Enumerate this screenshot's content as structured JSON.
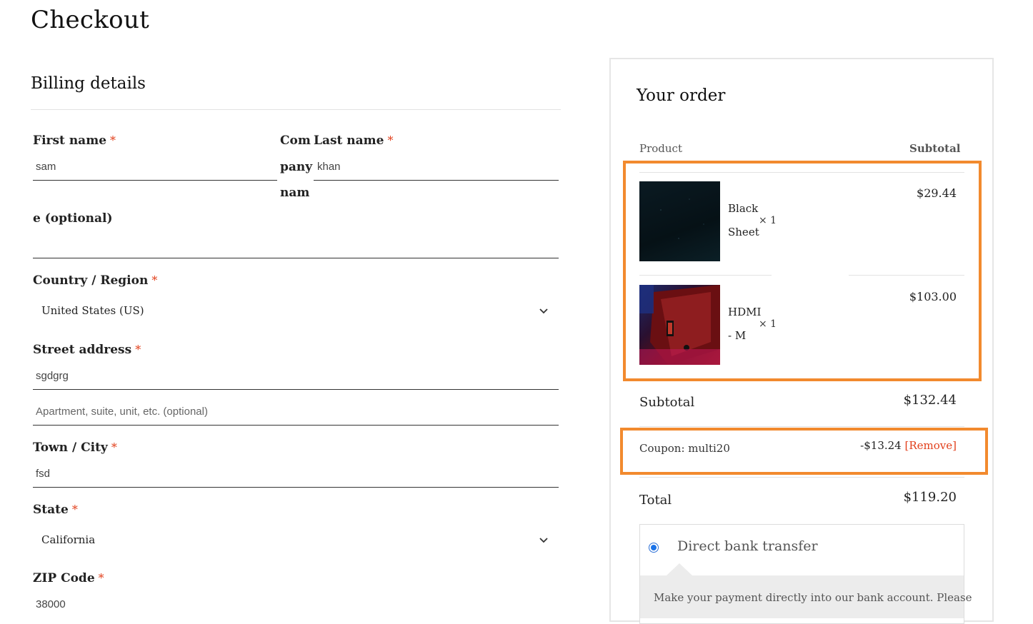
{
  "page": {
    "title": "Checkout"
  },
  "billing": {
    "title": "Billing details",
    "first_name": {
      "label": "First name",
      "required": "*",
      "value": "sam"
    },
    "company_name": {
      "label_lines": [
        "Com",
        "pany",
        "nam"
      ],
      "label_tail": "e (optional)",
      "value": ""
    },
    "last_name": {
      "label": "Last name",
      "required": "*",
      "value": "khan"
    },
    "country": {
      "label": "Country / Region",
      "required": "*",
      "value": "United States (US)"
    },
    "street": {
      "label": "Street address",
      "required": "*",
      "value": "sgdgrg",
      "placeholder": "Apartment, suite, unit, etc. (optional)"
    },
    "city": {
      "label": "Town / City",
      "required": "*",
      "value": "fsd"
    },
    "state": {
      "label": "State",
      "required": "*",
      "value": "California"
    },
    "zip": {
      "label": "ZIP Code",
      "required": "*",
      "value": "38000"
    }
  },
  "order": {
    "title": "Your order",
    "col_product": "Product",
    "col_subtotal": "Subtotal",
    "items": [
      {
        "name_lines": [
          "Black",
          "Sheet"
        ],
        "qty": "× 1",
        "price": "$29.44"
      },
      {
        "name_lines": [
          "HDMI",
          "- M"
        ],
        "qty": "× 1",
        "price": "$103.00"
      }
    ],
    "subtotal_label": "Subtotal",
    "subtotal_value": "$132.44",
    "coupon_label": "Coupon: multi20",
    "coupon_value": "-$13.24",
    "coupon_remove": "[Remove]",
    "total_label": "Total",
    "total_value": "$119.20",
    "payment": {
      "method": "Direct bank transfer",
      "description": "Make your payment directly into our bank account. Please"
    }
  },
  "colors": {
    "highlight": "#f28a2e",
    "required": "#e2401c",
    "radio": "#1a73e8"
  }
}
